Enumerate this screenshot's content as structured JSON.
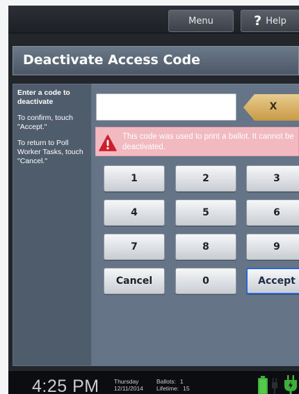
{
  "topbar": {
    "menu_label": "Menu",
    "help_glyph": "?",
    "help_label": "Help"
  },
  "page": {
    "title": "Deactivate Access Code"
  },
  "instructions": {
    "heading": "Enter a code to deactivate",
    "confirm": "To confirm, touch \"Accept.\"",
    "return": "To return to Poll Worker Tasks, touch \"Cancel.\""
  },
  "code_input": {
    "value": ""
  },
  "clear_button": {
    "label": "X"
  },
  "alert": {
    "icon": "warning-icon",
    "message": "This code was used to print a ballot. It cannot be deactivated."
  },
  "keypad": {
    "keys": [
      "1",
      "2",
      "3",
      "4",
      "5",
      "6",
      "7",
      "8",
      "9"
    ],
    "cancel_label": "Cancel",
    "zero_label": "0",
    "accept_label": "Accept"
  },
  "status": {
    "time": "4:25 PM",
    "day": "Thursday",
    "date": "12/11/2014",
    "ballots_label": "Ballots:",
    "ballots_value": "1",
    "lifetime_label": "Lifetime:",
    "lifetime_value": "15",
    "battery_icon": "battery-icon",
    "plug_icon": "plug-icon",
    "power_icon": "power-icon"
  },
  "colors": {
    "accent_blue": "#2b64d6",
    "alert_bg": "#f2b9c1",
    "alert_icon": "#cc1f2b",
    "clear_button": "#d4aa5c",
    "battery": "#3fae3a"
  }
}
